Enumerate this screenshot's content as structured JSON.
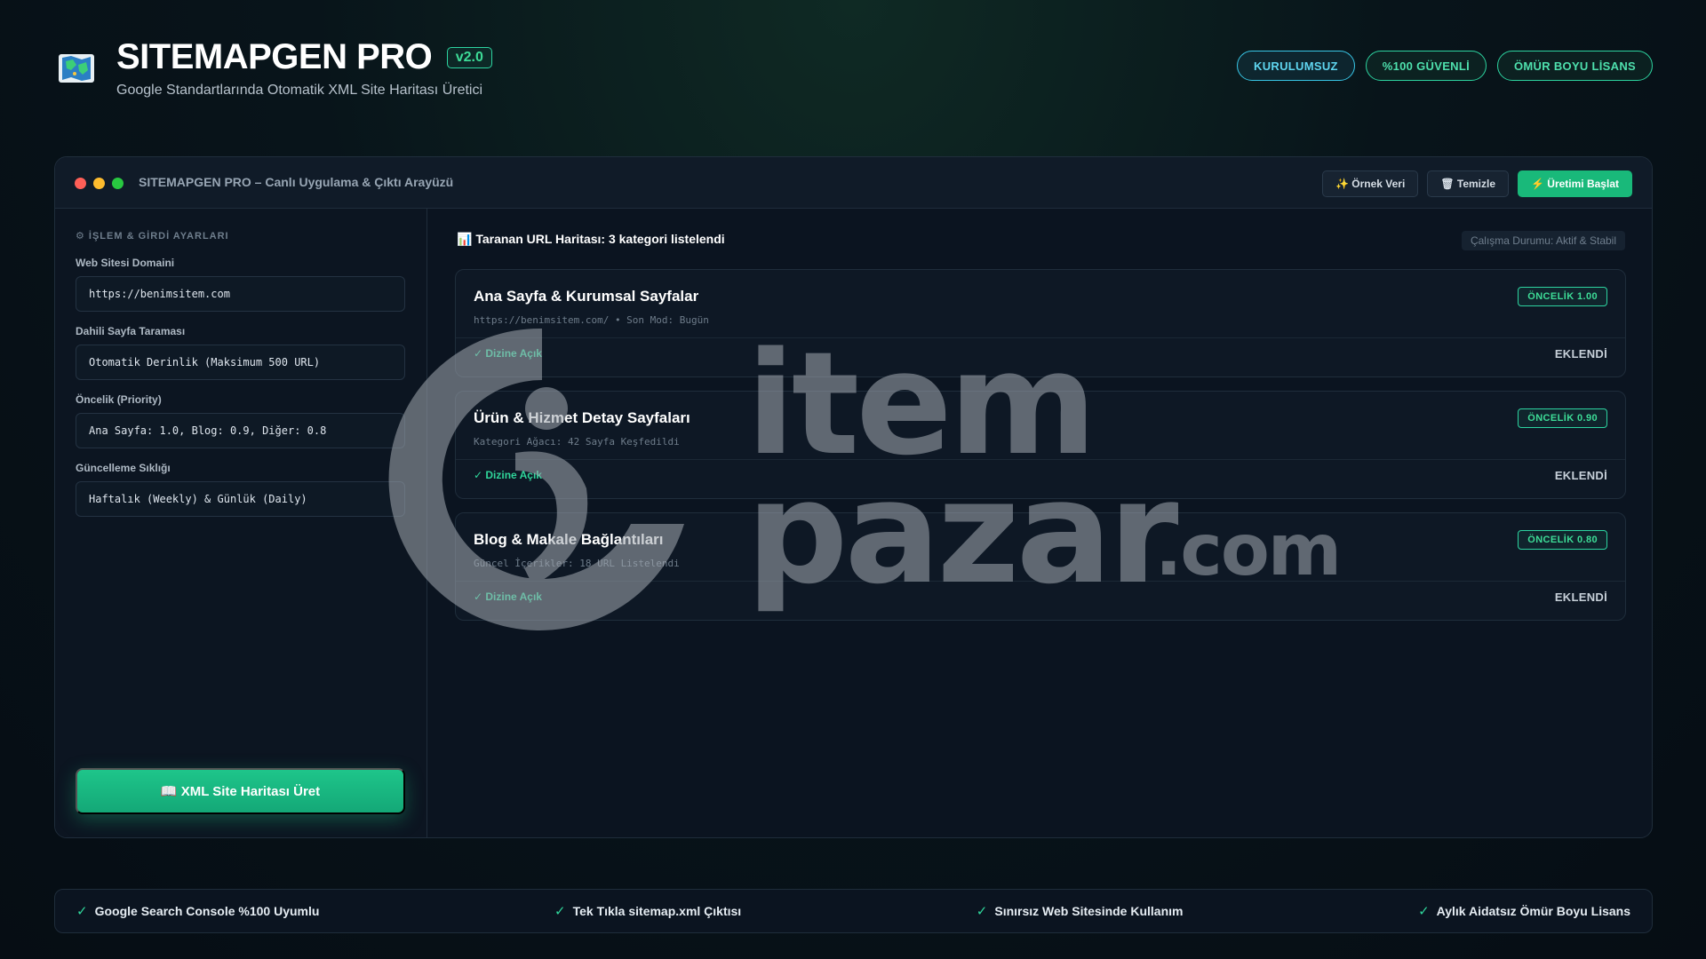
{
  "header": {
    "title": "SITEMAPGEN PRO",
    "version": "v2.0",
    "subtitle": "Google Standartlarında Otomatik XML Site Haritası Üretici",
    "pills": [
      "KURULUMSUZ",
      "%100 GÜVENLİ",
      "ÖMÜR BOYU LİSANS"
    ]
  },
  "window": {
    "title": "SITEMAPGEN PRO – Canlı Uygulama & Çıktı Arayüzü",
    "actions": {
      "sample": "✨ Örnek Veri",
      "clear": "🗑 Temizle",
      "start": "⚡ Üretimi Başlat"
    }
  },
  "sidebar": {
    "section_title": "⚙ İŞLEM & GİRDİ AYARLARI",
    "fields": [
      {
        "label": "Web Sitesi Domaini",
        "value": "https://benimsitem.com"
      },
      {
        "label": "Dahili Sayfa Taraması",
        "value": "Otomatik Derinlik (Maksimum 500 URL)"
      },
      {
        "label": "Öncelik (Priority)",
        "value": "Ana Sayfa: 1.0, Blog: 0.9, Diğer: 0.8"
      },
      {
        "label": "Güncelleme Sıklığı",
        "value": "Haftalık (Weekly) & Günlük (Daily)"
      }
    ],
    "generate_button": "📖 XML Site Haritası Üret"
  },
  "main": {
    "heading": "📊 Taranan URL Haritası: 3 kategori listelendi",
    "status": "Çalışma Durumu: Aktif & Stabil",
    "cards": [
      {
        "title": "Ana Sayfa & Kurumsal Sayfalar",
        "meta": "https://benimsitem.com/ • Son Mod: Bugün",
        "badge": "ÖNCELİK 1.00",
        "index": "✓ Dizine Açık",
        "added": "EKLENDİ"
      },
      {
        "title": "Ürün & Hizmet Detay Sayfaları",
        "meta": "Kategori Ağacı: 42 Sayfa Keşfedildi",
        "badge": "ÖNCELİK 0.90",
        "index": "✓ Dizine Açık",
        "added": "EKLENDİ"
      },
      {
        "title": "Blog & Makale Bağlantıları",
        "meta": "Güncel İçerikler: 18 URL Listelendi",
        "badge": "ÖNCELİK 0.80",
        "index": "✓ Dizine Açık",
        "added": "EKLENDİ"
      }
    ]
  },
  "watermark": {
    "line1": "item",
    "line2": "pazar",
    "suffix": ".com"
  },
  "footer": {
    "features": [
      "Google Search Console %100 Uyumlu",
      "Tek Tıkla sitemap.xml Çıktısı",
      "Sınırsız Web Sitesinde Kullanım",
      "Aylık Aidatsız Ömür Boyu Lisans"
    ],
    "check": "✓"
  },
  "colors": {
    "accent": "#19b97a",
    "accent_text": "#3ddc97",
    "cyan": "#38c6e6",
    "dot_red": "#ff5f57",
    "dot_yellow": "#febc2e",
    "dot_green": "#28c840"
  }
}
